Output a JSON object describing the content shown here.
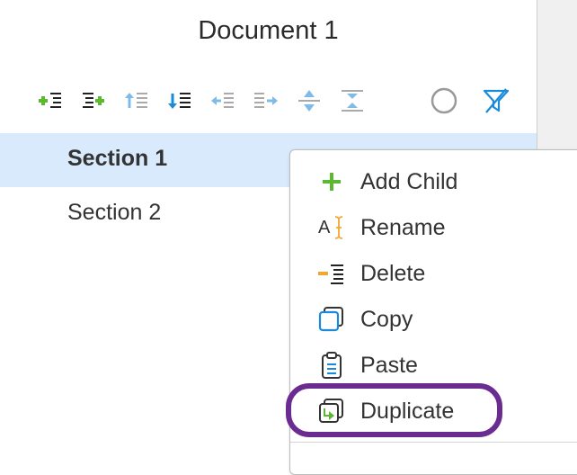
{
  "document": {
    "title": "Document 1"
  },
  "toolbar": {
    "icons": [
      "add-child-icon",
      "add-sibling-icon",
      "move-up-icon",
      "move-down-icon",
      "outdent-icon",
      "indent-icon",
      "collapse-icon",
      "expand-icon",
      "circle-icon",
      "filter-icon"
    ]
  },
  "tree": {
    "items": [
      {
        "label": "Section 1",
        "selected": true
      },
      {
        "label": "Section 2",
        "selected": false
      }
    ]
  },
  "context_menu": {
    "items": [
      {
        "label": "Add Child",
        "icon": "plus-icon"
      },
      {
        "label": "Rename",
        "icon": "rename-icon"
      },
      {
        "label": "Delete",
        "icon": "delete-icon"
      },
      {
        "label": "Copy",
        "icon": "copy-icon"
      },
      {
        "label": "Paste",
        "icon": "paste-icon"
      },
      {
        "label": "Duplicate",
        "icon": "duplicate-icon"
      }
    ]
  },
  "colors": {
    "accent_blue": "#1a8bdb",
    "light_blue": "#7fbbe8",
    "green": "#5cb82e",
    "orange": "#f2a633",
    "selection": "#d8eafc",
    "highlight_ring": "#6a2c91"
  }
}
